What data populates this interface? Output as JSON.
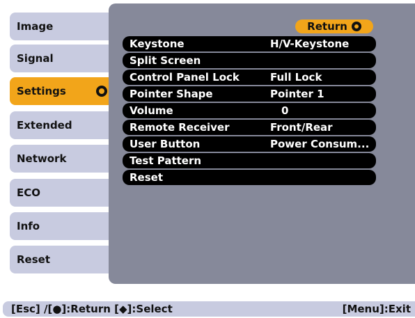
{
  "sidebar": {
    "items": [
      {
        "label": "Image"
      },
      {
        "label": "Signal"
      },
      {
        "label": "Settings",
        "active": true
      },
      {
        "label": "Extended"
      },
      {
        "label": "Network"
      },
      {
        "label": "ECO"
      },
      {
        "label": "Info"
      },
      {
        "label": "Reset"
      }
    ]
  },
  "main": {
    "return_label": "Return",
    "rows": [
      {
        "label": "Keystone",
        "value": "H/V-Keystone"
      },
      {
        "label": "Split Screen",
        "value": ""
      },
      {
        "label": "Control Panel Lock",
        "value": "Full Lock"
      },
      {
        "label": "Pointer Shape",
        "value": "Pointer 1"
      },
      {
        "label": "Volume",
        "value": "0"
      },
      {
        "label": "Remote Receiver",
        "value": "Front/Rear"
      },
      {
        "label": "User Button",
        "value": "Power Consum..."
      },
      {
        "label": "Test Pattern",
        "value": ""
      },
      {
        "label": "Reset",
        "value": ""
      }
    ]
  },
  "footer": {
    "left": "[Esc] /[●]:Return [◆]:Select",
    "right": "[Menu]:Exit"
  },
  "colors": {
    "accent": "#f2a51a",
    "sidebar_bg": "#c8cbe0",
    "panel_bg": "#86899a",
    "row_bg": "#000000"
  }
}
